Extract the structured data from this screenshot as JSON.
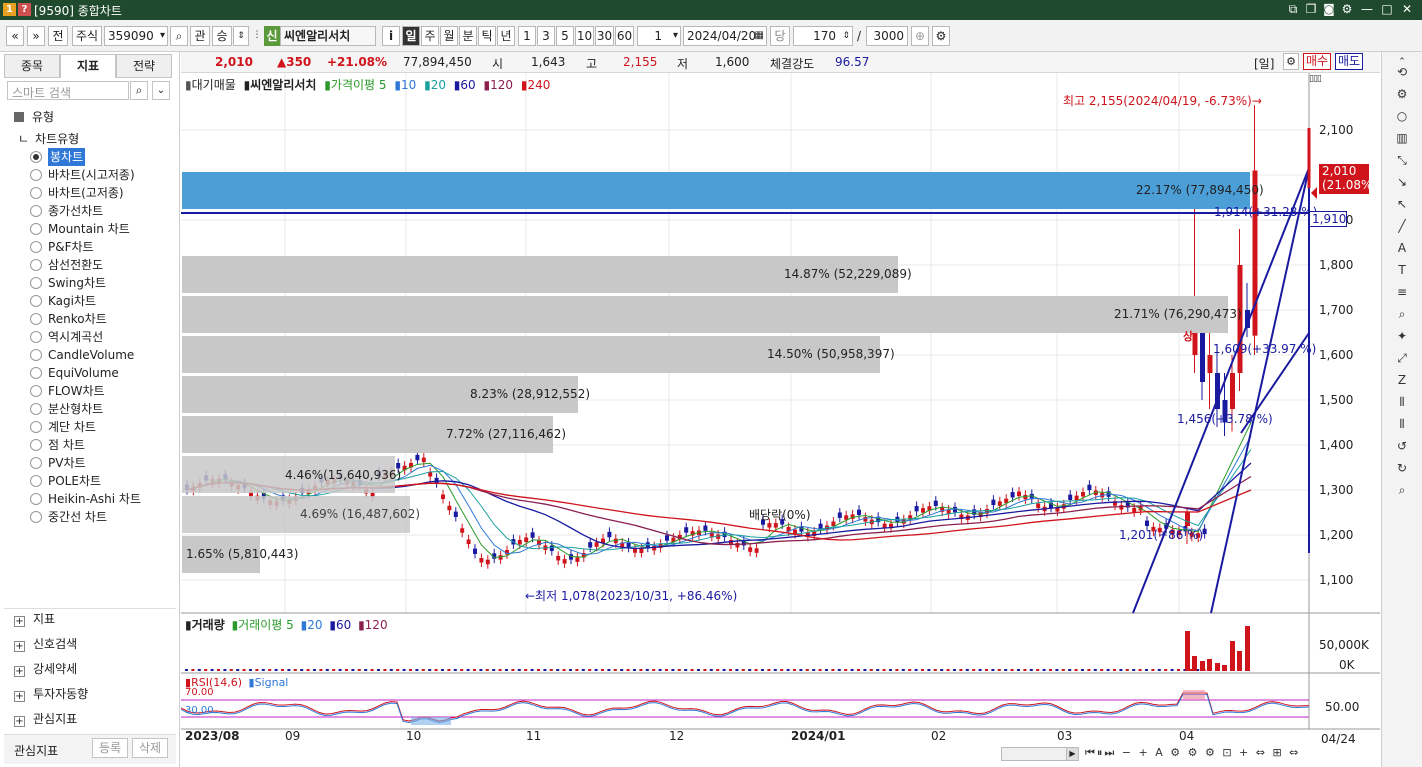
{
  "window": {
    "title": "[9590] 종합차트",
    "icons": [
      "question-icon",
      "help-icon"
    ]
  },
  "toolbar": {
    "prev": "«",
    "next": "»",
    "jeon": "전",
    "market": "주식",
    "code": "359090",
    "gwan": "관",
    "seung": "승",
    "badge": "신",
    "name": "씨엔알리서치",
    "info": "i",
    "periods": [
      "일",
      "주",
      "월",
      "분",
      "틱",
      "년"
    ],
    "minutes": [
      "1",
      "3",
      "5",
      "10",
      "30",
      "60"
    ],
    "interval": "1",
    "date": "2024/04/20",
    "dang": "당",
    "count": "170",
    "slash": "/",
    "total": "3000"
  },
  "left": {
    "tabs": [
      "종목",
      "지표",
      "전략"
    ],
    "search_placeholder": "스마트 검색",
    "category": "유형",
    "chart_type_header": "차트유형",
    "chart_types": [
      "봉차트",
      "바차트(시고저종)",
      "바차트(고저종)",
      "종가선차트",
      "Mountain 차트",
      "P&F차트",
      "삼선전환도",
      "Swing차트",
      "Kagi차트",
      "Renko차트",
      "역시계곡선",
      "CandleVolume",
      "EquiVolume",
      "FLOW차트",
      "분산형차트",
      "계단 차트",
      "점 차트",
      "PV차트",
      "POLE차트",
      "Heikin-Ashi 차트",
      "중간선 차트"
    ],
    "selected": "봉차트",
    "sections": [
      "지표",
      "신호검색",
      "강세약세",
      "투자자동향",
      "관심지표"
    ],
    "bottom_label": "관심지표",
    "register": "등록",
    "delete": "삭제"
  },
  "info": {
    "price": "2,010",
    "change": "▲350",
    "pct": "+21.08%",
    "volume": "77,894,450",
    "open_label": "시",
    "open": "1,643",
    "high_label": "고",
    "high": "2,155",
    "low_label": "저",
    "low": "1,600",
    "strength_label": "체결강도",
    "strength": "96.57",
    "period": "[일]",
    "buy": "매수",
    "sell": "매도"
  },
  "legend": {
    "items": [
      "대기매물",
      "씨엔알리서치",
      "가격이평 5",
      "10",
      "20",
      "60",
      "120",
      "240"
    ]
  },
  "annotations": {
    "high": "최고 2,155(2024/04/19, -6.73%)→",
    "low": "←최저 1,078(2023/10/31, +86.46%)",
    "dividend": "배당락(0%)",
    "sig": "상",
    "line1": "1,914(+31.28 %)",
    "line2": "1,609(+33.97 %)",
    "line3": "1,456(+3.78 %)",
    "line4": "1,201(+86 %)",
    "pivot": "4.46%(15,640,936)"
  },
  "volume_profile": [
    {
      "label": "22.17% (77,894,450)"
    },
    {
      "label": "14.87% (52,229,089)"
    },
    {
      "label": "21.71% (76,290,473)"
    },
    {
      "label": "14.50% (50,958,397)"
    },
    {
      "label": "8.23% (28,912,552)"
    },
    {
      "label": "7.72% (27,116,462)"
    },
    {
      "label": "4.69% (16,487,602)"
    },
    {
      "label": "1.65% (5,810,443)"
    }
  ],
  "price_axis": [
    "2,100",
    "2,000",
    "1,900",
    "1,800",
    "1,700",
    "1,600",
    "1,500",
    "1,400",
    "1,300",
    "1,200",
    "1,100"
  ],
  "current_price": {
    "value": "2,010",
    "pct": "(21.08%)",
    "line": "1,910"
  },
  "volume_panel": {
    "legend": [
      "거래량",
      "거래이평 5",
      "20",
      "60",
      "120"
    ],
    "axis": [
      "50,000K",
      "0K"
    ]
  },
  "rsi_panel": {
    "legend": [
      "RSI(14,6)",
      "Signal"
    ],
    "levels": [
      "70.00",
      "30.00"
    ],
    "axis": "50.00"
  },
  "x_axis": [
    "2023/08",
    "09",
    "10",
    "11",
    "12",
    "2024/01",
    "02",
    "03",
    "04"
  ],
  "x_end": "04/24",
  "colors": {
    "title_bg": "#1f4a2d",
    "up": "#d0141c",
    "down": "#1a1aa0",
    "profile": "#c8c8c8",
    "profile_hl": "#4b9ed6",
    "accent": "#2f78d7"
  }
}
